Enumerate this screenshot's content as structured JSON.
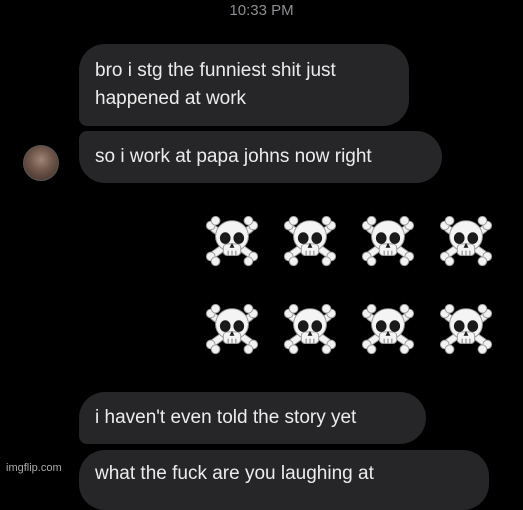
{
  "status": {
    "timestamp": "10:33 PM"
  },
  "messages": [
    {
      "text": "bro i stg the funniest shit just\nhappened at work"
    },
    {
      "text": "so i work at papa johns now right"
    },
    {
      "text": "i haven't even told the story yet"
    },
    {
      "text": "what the fuck are you laughing at"
    }
  ],
  "reaction": {
    "emoji_icon": "skull-and-crossbones-icon",
    "count": 8,
    "rows": 2,
    "per_row": 4
  },
  "watermark": {
    "text": "imgflip.com"
  },
  "colors": {
    "background": "#000000",
    "bubble": "#262628",
    "text": "#ececec",
    "timestamp": "#8e8e93"
  }
}
